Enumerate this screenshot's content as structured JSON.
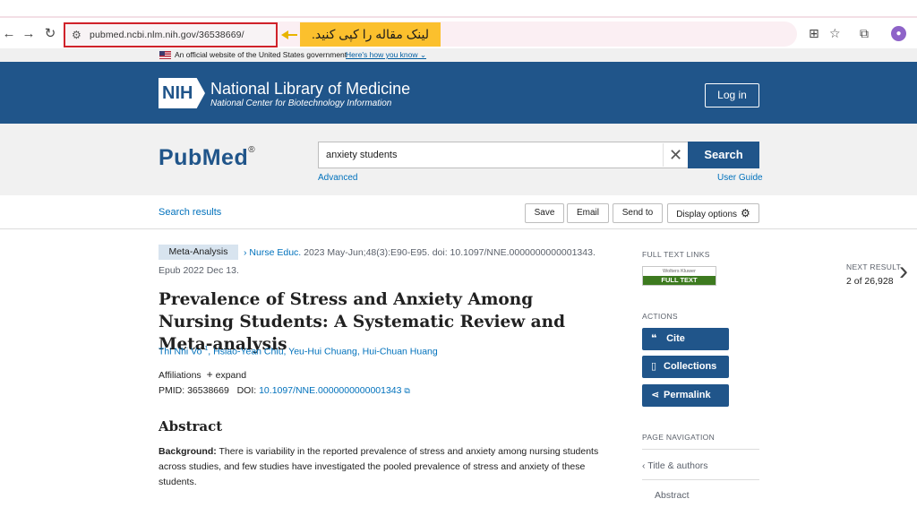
{
  "browser": {
    "url": "pubmed.ncbi.nlm.nih.gov/36538669/",
    "callout": "لینک مقاله را کپی کنید."
  },
  "gov_banner": {
    "text": "An official website of the United States government",
    "link": "Here's how you know"
  },
  "nlm": {
    "logo": "NIH",
    "title": "National Library of Medicine",
    "subtitle": "National Center for Biotechnology Information",
    "login": "Log in"
  },
  "search": {
    "logo": "PubMed",
    "query": "anxiety students",
    "button": "Search",
    "advanced": "Advanced",
    "user_guide": "User Guide"
  },
  "actions_bar": {
    "search_results": "Search results",
    "save": "Save",
    "email": "Email",
    "send_to": "Send to",
    "display_options": "Display options"
  },
  "article": {
    "type": "Meta-Analysis",
    "journal": "Nurse Educ",
    "citation": "2023 May-Jun;48(3):E90-E95. doi: 10.1097/NNE.0000000000001343.",
    "epub": "Epub 2022 Dec 13.",
    "title": "Prevalence of Stress and Anxiety Among Nursing Students: A Systematic Review and Meta-analysis",
    "author1": "Thi Nhi Vo",
    "author1_sup": "1",
    "authors_rest": ", Hsiao-Yean Chiu, Yeu-Hui Chuang, Hui-Chuan Huang",
    "affiliations": "Affiliations",
    "expand": "expand",
    "pmid_label": "PMID:",
    "pmid": "36538669",
    "doi_label": "DOI:",
    "doi": "10.1097/NNE.0000000000001343",
    "abstract_heading": "Abstract",
    "background_label": "Background:",
    "background_text": "There is variability in the reported prevalence of stress and anxiety among nursing students across studies, and few studies have investigated the pooled prevalence of stress and anxiety of these students."
  },
  "sidebar": {
    "full_text_links": "FULL TEXT LINKS",
    "ft_publisher": "Wolters Kluwer",
    "ft_label": "FULL TEXT",
    "actions": "ACTIONS",
    "cite": "Cite",
    "collections": "Collections",
    "permalink": "Permalink",
    "page_navigation": "PAGE NAVIGATION",
    "nav_title_authors": "Title & authors",
    "nav_abstract": "Abstract"
  },
  "next_result": {
    "label": "NEXT RESULT",
    "count": "2 of 26,928"
  }
}
